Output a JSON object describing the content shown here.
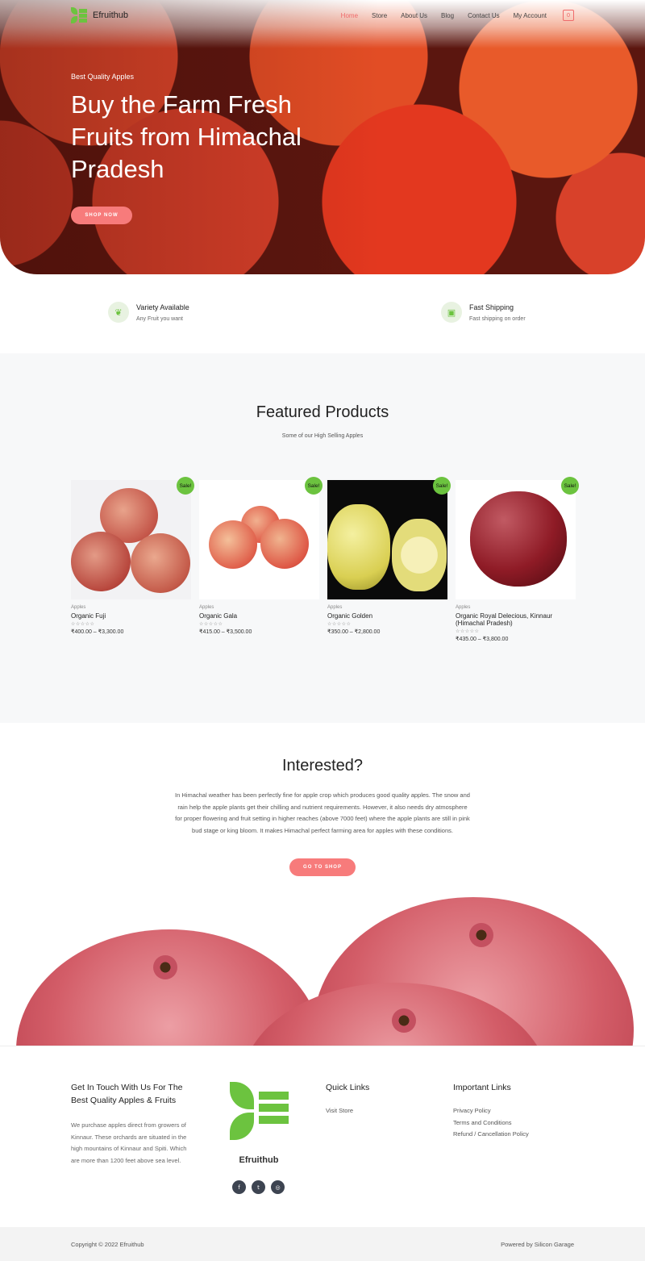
{
  "brand": {
    "name": "Efruithub",
    "accent": "#6cc33f",
    "pink": "#f77b7b"
  },
  "nav": {
    "items": [
      {
        "label": "Home",
        "active": true
      },
      {
        "label": "Store"
      },
      {
        "label": "About Us"
      },
      {
        "label": "Blog"
      },
      {
        "label": "Contact Us"
      },
      {
        "label": "My Account"
      }
    ],
    "cart_count": "0"
  },
  "hero": {
    "eyebrow": "Best Quality Apples",
    "title": "Buy the Farm Fresh Fruits from Himachal Pradesh",
    "button": "SHOP NOW"
  },
  "features": [
    {
      "icon": "leaf-icon",
      "title": "Variety Available",
      "subtitle": "Any Fruit you want"
    },
    {
      "icon": "box-icon",
      "title": "Fast Shipping",
      "subtitle": "Fast shipping on order"
    }
  ],
  "featured": {
    "title": "Featured Products",
    "subtitle": "Some of our High Selling Apples",
    "sale_label": "Sale!",
    "stars": "☆☆☆☆☆",
    "products": [
      {
        "category": "Apples",
        "name": "Organic Fuji",
        "price": "₹400.00 – ₹3,300.00"
      },
      {
        "category": "Apples",
        "name": "Organic Gala",
        "price": "₹415.00 – ₹3,500.00"
      },
      {
        "category": "Apples",
        "name": "Organic Golden",
        "price": "₹350.00 – ₹2,800.00"
      },
      {
        "category": "Apples",
        "name": "Organic Royal Delecious, Kinnaur (Himachal Pradesh)",
        "price": "₹435.00 – ₹3,800.00"
      }
    ]
  },
  "interested": {
    "title": "Interested?",
    "text": "In Himachal weather has been perfectly fine for apple crop which produces good quality apples. The snow and rain help the apple plants get their chilling and nutrient requirements. However, it also needs dry atmosphere for proper flowering and fruit setting in higher reaches (above 7000 feet) where the apple plants are still in pink bud stage or king bloom. It makes Himachal perfect farming area for apples with these conditions.",
    "button": "GO TO SHOP"
  },
  "footer": {
    "contact_heading": "Get In Touch With Us For The Best Quality Apples & Fruits",
    "contact_text": "We purchase apples direct from growers of Kinnaur. These orchards are situated in the high mountains of Kinnaur and Spiti. Which are more than 1200 feet above sea level.",
    "brand": "Efruithub",
    "socials": [
      "facebook-icon",
      "twitter-icon",
      "instagram-icon"
    ],
    "quick_links_heading": "Quick Links",
    "quick_links": [
      "Visit Store"
    ],
    "important_links_heading": "Important Links",
    "important_links": [
      "Privacy Policy",
      "Terms and Conditions",
      "Refund / Cancellation Policy"
    ]
  },
  "bottom_bar": {
    "copyright": "Copyright © 2022 Efruithub",
    "powered": "Powered by Silicon Garage"
  }
}
